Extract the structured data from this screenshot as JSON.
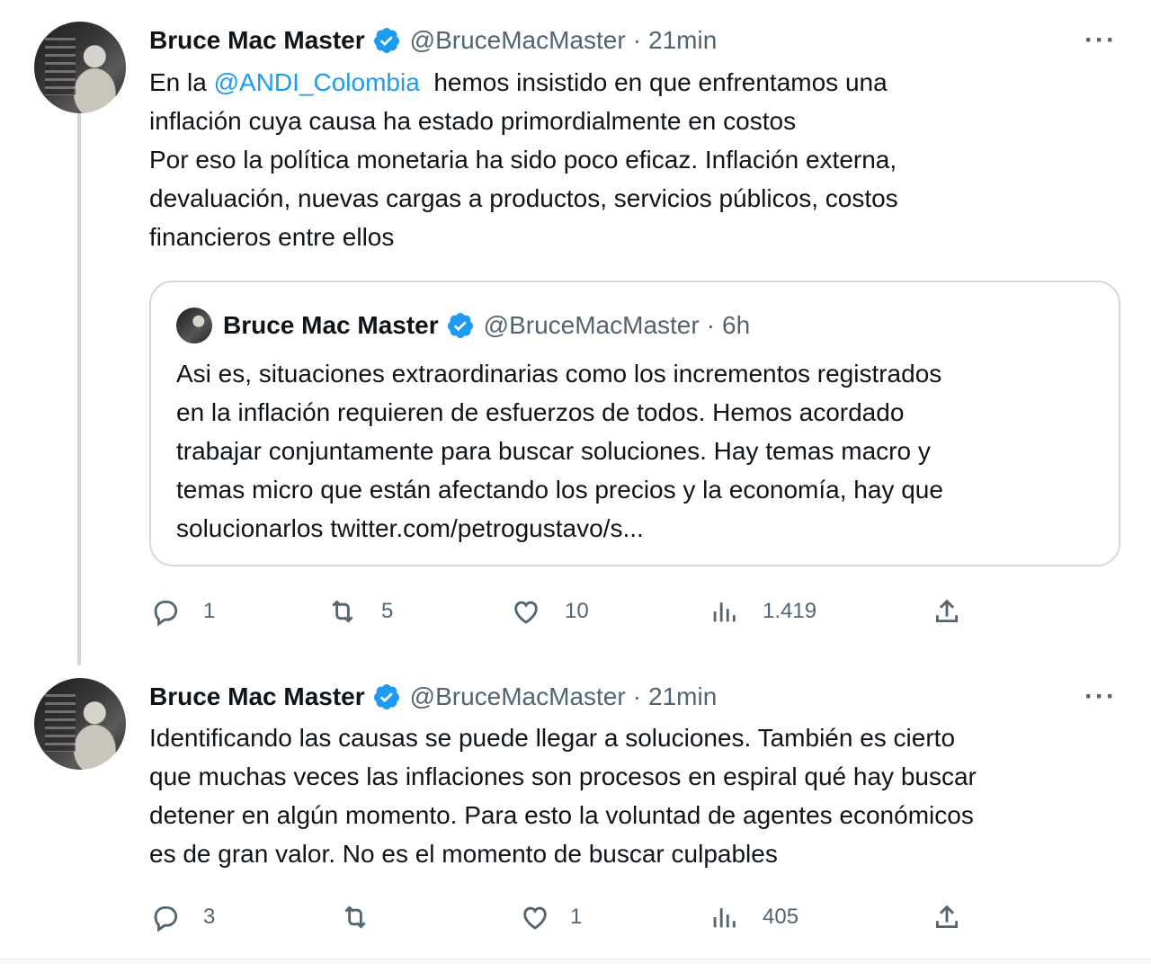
{
  "tweets": [
    {
      "author": "Bruce Mac Master",
      "handle": "@BruceMacMaster",
      "separator": "·",
      "time": "21min",
      "more": "···",
      "body": {
        "line1_prefix": "En la ",
        "line1_mention": "@ANDI_Colombia",
        "line1_suffix": "  hemos insistido en que enfrentamos una",
        "line2": "inflación cuya causa ha estado primordialmente en costos",
        "line3": "Por eso la política monetaria ha sido poco eficaz. Inflación externa,",
        "line4": "devaluación, nuevas cargas a productos, servicios públicos, costos",
        "line5": "financieros entre ellos"
      },
      "quote": {
        "author": "Bruce Mac Master",
        "handle": "@BruceMacMaster",
        "separator": "·",
        "time": "6h",
        "lines": [
          "Asi es, situaciones extraordinarias como los incrementos registrados",
          "en la inflación requieren de esfuerzos de todos. Hemos acordado",
          "trabajar conjuntamente para buscar soluciones. Hay temas macro y",
          "temas micro que están afectando los precios y la economía, hay que",
          "solucionarlos twitter.com/petrogustavo/s..."
        ]
      },
      "actions": {
        "replies": "1",
        "retweets": "5",
        "likes": "10",
        "views": "1.419"
      }
    },
    {
      "author": "Bruce Mac Master",
      "handle": "@BruceMacMaster",
      "separator": "·",
      "time": "21min",
      "more": "···",
      "lines": [
        "Identificando las causas se puede llegar a soluciones. También es cierto",
        "que muchas veces las inflaciones son procesos en espiral qué hay buscar",
        "detener en algún momento. Para esto la voluntad de agentes económicos",
        "es de gran valor. No es el momento de buscar culpables"
      ],
      "actions": {
        "replies": "3",
        "retweets": "",
        "likes": "1",
        "views": "405"
      }
    }
  ],
  "colors": {
    "accent": "#1d9bf0",
    "text": "#0f1419",
    "muted": "#536471",
    "border": "#cfd9de"
  },
  "icons": [
    "verified-badge-icon",
    "more-icon",
    "reply-icon",
    "retweet-icon",
    "like-icon",
    "views-icon",
    "share-icon"
  ]
}
